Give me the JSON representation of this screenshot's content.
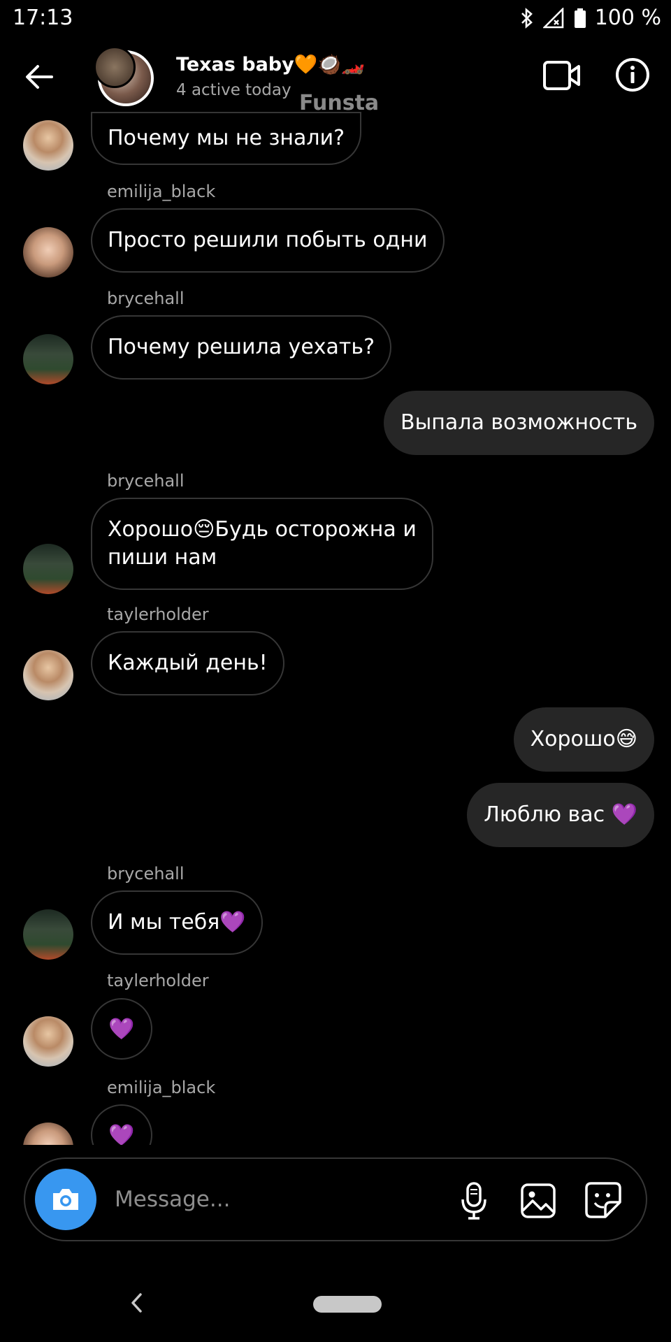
{
  "status_bar": {
    "time": "17:13",
    "battery": "100 %",
    "icons": [
      "bluetooth-icon",
      "signal-icon",
      "battery-icon"
    ]
  },
  "header": {
    "title": "Texas baby🧡🥥🏎️",
    "subtitle": "4 active today",
    "overlay_text": "Funsta",
    "icons": [
      "back-arrow-icon",
      "video-call-icon",
      "info-icon"
    ]
  },
  "messages": [
    {
      "direction": "in",
      "sender": "",
      "avatar": "taylerholder",
      "text": "Почему мы не знали?"
    },
    {
      "direction": "in",
      "sender": "emilija_black",
      "avatar": "emilija_black",
      "text": "Просто решили побыть одни"
    },
    {
      "direction": "in",
      "sender": "brycehall",
      "avatar": "brycehall",
      "text": "Почему решила уехать?"
    },
    {
      "direction": "out",
      "sender": "",
      "text": "Выпала возможность"
    },
    {
      "direction": "in",
      "sender": "brycehall",
      "avatar": "brycehall",
      "text_line1": "Хорошо😔Будь осторожна и",
      "text_line2": "пиши нам"
    },
    {
      "direction": "in",
      "sender": "taylerholder",
      "avatar": "taylerholder",
      "text": "Каждый день!"
    },
    {
      "direction": "out",
      "sender": "",
      "text": "Хорошо😅"
    },
    {
      "direction": "out",
      "sender": "",
      "text": "Люблю вас 💜"
    },
    {
      "direction": "in",
      "sender": "brycehall",
      "avatar": "brycehall",
      "text": "И мы тебя💜"
    },
    {
      "direction": "in",
      "sender": "taylerholder",
      "avatar": "taylerholder",
      "text": "💜"
    },
    {
      "direction": "in",
      "sender": "emilija_black",
      "avatar": "emilija_black",
      "text": "💜"
    }
  ],
  "composer": {
    "placeholder": "Message...",
    "icons": [
      "camera-icon",
      "microphone-icon",
      "gallery-icon",
      "sticker-icon"
    ],
    "camera_color": "#3897f0"
  },
  "nav_bar": {
    "icons": [
      "nav-back-icon",
      "home-pill-icon"
    ]
  },
  "colors": {
    "background": "#000000",
    "outgoing_bubble": "#262626",
    "incoming_border": "#363636",
    "secondary_text": "#a8a8a8"
  }
}
